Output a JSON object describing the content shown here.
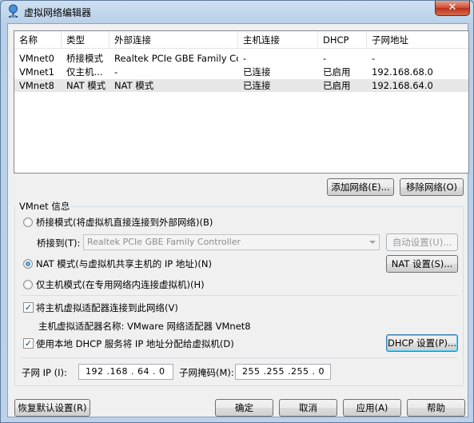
{
  "window": {
    "title": "虚拟网络编辑器",
    "close_label": "✕"
  },
  "network_list": {
    "columns": [
      "名称",
      "类型",
      "外部连接",
      "主机连接",
      "DHCP",
      "子网地址"
    ],
    "rows": [
      {
        "name": "VMnet0",
        "type": "桥接模式",
        "external": "Realtek PCIe GBE Family Co...",
        "host": "-",
        "dhcp": "-",
        "subnet": "-"
      },
      {
        "name": "VMnet1",
        "type": "仅主机...",
        "external": "-",
        "host": "已连接",
        "dhcp": "已启用",
        "subnet": "192.168.68.0"
      },
      {
        "name": "VMnet8",
        "type": "NAT 模式",
        "external": "NAT 模式",
        "host": "已连接",
        "dhcp": "已启用",
        "subnet": "192.168.64.0"
      }
    ],
    "selected_row": 2
  },
  "list_buttons": {
    "add": "添加网络(E)...",
    "remove": "移除网络(O)"
  },
  "vmnet_info": {
    "group_label": "VMnet 信息",
    "bridged_radio": "桥接模式(将虚拟机直接连接到外部网络)(B)",
    "bridged_to_label": "桥接到(T):",
    "bridged_to_value": "Realtek PCIe GBE Family Controller",
    "auto_settings": "自动设置(U)...",
    "nat_radio": "NAT 模式(与虚拟机共享主机的 IP 地址)(N)",
    "nat_settings": "NAT 设置(S)...",
    "hostonly_radio": "仅主机模式(在专用网络内连接虚拟机)(H)",
    "selected_mode": "nat",
    "connect_adapter_checkbox": "将主机虚拟适配器连接到此网络(V)",
    "connect_adapter_checked": true,
    "adapter_name_label": "主机虚拟适配器名称: VMware 网络适配器 VMnet8",
    "dhcp_checkbox": "使用本地 DHCP 服务将 IP 地址分配给虚拟机(D)",
    "dhcp_checked": true,
    "dhcp_settings": "DHCP 设置(P)...",
    "subnet_ip_label": "子网 IP (I):",
    "subnet_ip_value": "192 .168 . 64 .  0",
    "subnet_mask_label": "子网掩码(M):",
    "subnet_mask_value": "255 .255 .255 .  0"
  },
  "footer_buttons": {
    "restore_defaults": "恢复默认设置(R)",
    "ok": "确定",
    "cancel": "取消",
    "apply": "应用(A)",
    "help": "帮助"
  }
}
